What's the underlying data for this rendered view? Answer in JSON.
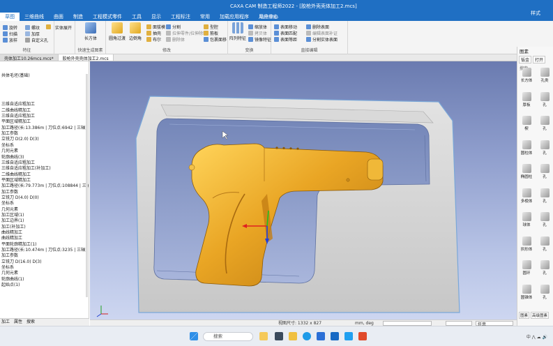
{
  "window": {
    "title": "CAXA CAM 制造工程师2022 - [胶枪外壳壳体加工2.mcs]",
    "style_label": "样式"
  },
  "menu": {
    "items": [
      "草图",
      "三维曲线",
      "曲面",
      "制造",
      "工程模式零件",
      "工具",
      "显示",
      "工程标注",
      "常用",
      "加载应用程序",
      "用户中心"
    ],
    "active_index": 0,
    "search_placeholder": "功能搜索"
  },
  "ribbon": {
    "group1": {
      "items": [
        "旋转",
        "螺纹",
        "扫描",
        "加厚",
        "放样",
        "自定义孔",
        "实体展开"
      ],
      "label": "特征"
    },
    "group2": {
      "big_label": "长方体",
      "label": "快速生成图素"
    },
    "group3": {
      "big1": "圆角过渡",
      "big2": "边倒角",
      "items": [
        "面拔模",
        "分割",
        "抽壳",
        "拉伸零件/拉伸除料",
        "布尔",
        "删除体",
        "型腔",
        "筋板",
        "包裹面移"
      ],
      "label": "修改"
    },
    "group4": {
      "big_label": "阵列特征",
      "items": [
        "缩放体",
        "拷贝体",
        "镜像特征"
      ],
      "label": "变换"
    },
    "group5": {
      "items": [
        "表面移动",
        "删除表面",
        "表面匹配",
        "编辑表面补证",
        "表面等距",
        "分割实体表面"
      ],
      "label": "直接编辑"
    }
  },
  "doc_tabs": [
    "壳体加工10.26mcs.mcs*",
    "胶枪外壳壳体加工2.mcs"
  ],
  "tree": {
    "rows": [
      "",
      "",
      "共体毛坯(基础)",
      "",
      "",
      "",
      "",
      "三维自适应粗加工",
      "二维曲线精加工",
      "三维自适应粗加工",
      "平面区域精加工",
      "加工路径(长:13.386m | 刀位点:6942 | 三轴)",
      "加工参数",
      "立铣刀 D(2.0) D(3)",
      "坐标系",
      "几何元素",
      "轮廓曲线(3)",
      "三维自适应粗加工",
      "三维自适应粗加工(补加工)",
      "二维曲线精加工",
      "平面区域精加工",
      "加工路径(长:79.773m | 刀位点:108844 | 三轴)",
      "加工参数",
      "立铣刀 D(4.0) D(0)",
      "坐标系",
      "几何元素",
      "加工区域(1)",
      "加工边界(1)",
      "加工(补加工)",
      "曲线精加工",
      "曲线精加工",
      "平面轮廓精加工(1)",
      "加工路径(长:10.474m | 刀位点:3235 | 三轴)",
      "加工参数",
      "立铣刀 D(16.0) D(3)",
      "坐标系",
      "几何元素",
      "轮廓曲线(1)",
      "起始点(1)",
      "",
      ""
    ]
  },
  "left_bottom_tabs": [
    "加工",
    "属性",
    "搜索"
  ],
  "status": {
    "view_size": "视图尺寸: 1332 x 827",
    "units": "mm, deg",
    "right_field": "任意"
  },
  "right_panel": {
    "title": "图素",
    "tabs": [
      "钣金",
      "打开"
    ],
    "search_label": "搜索...",
    "library": [
      [
        "长方体",
        "孔类"
      ],
      [
        "厚板",
        "孔"
      ],
      [
        "楔",
        "孔"
      ],
      [
        "圆柱体",
        "孔"
      ],
      [
        "椭圆柱",
        "孔"
      ],
      [
        "多棱体",
        "孔"
      ],
      [
        "球体",
        "孔"
      ],
      [
        "拱形体",
        "孔"
      ],
      [
        "圆环",
        "孔"
      ],
      [
        "圆锥体",
        "孔"
      ]
    ],
    "bottom_tabs": [
      "图素",
      "高级图素"
    ]
  },
  "taskbar": {
    "search_label": "搜索",
    "tray": "中 ⋀ ☁ 🔊"
  },
  "colors": {
    "title_blue": "#1f6fc3",
    "part_gold": "#e6a020",
    "fixture_gray": "#d4d4d4",
    "viewport_bg": "#8e9dcc"
  }
}
